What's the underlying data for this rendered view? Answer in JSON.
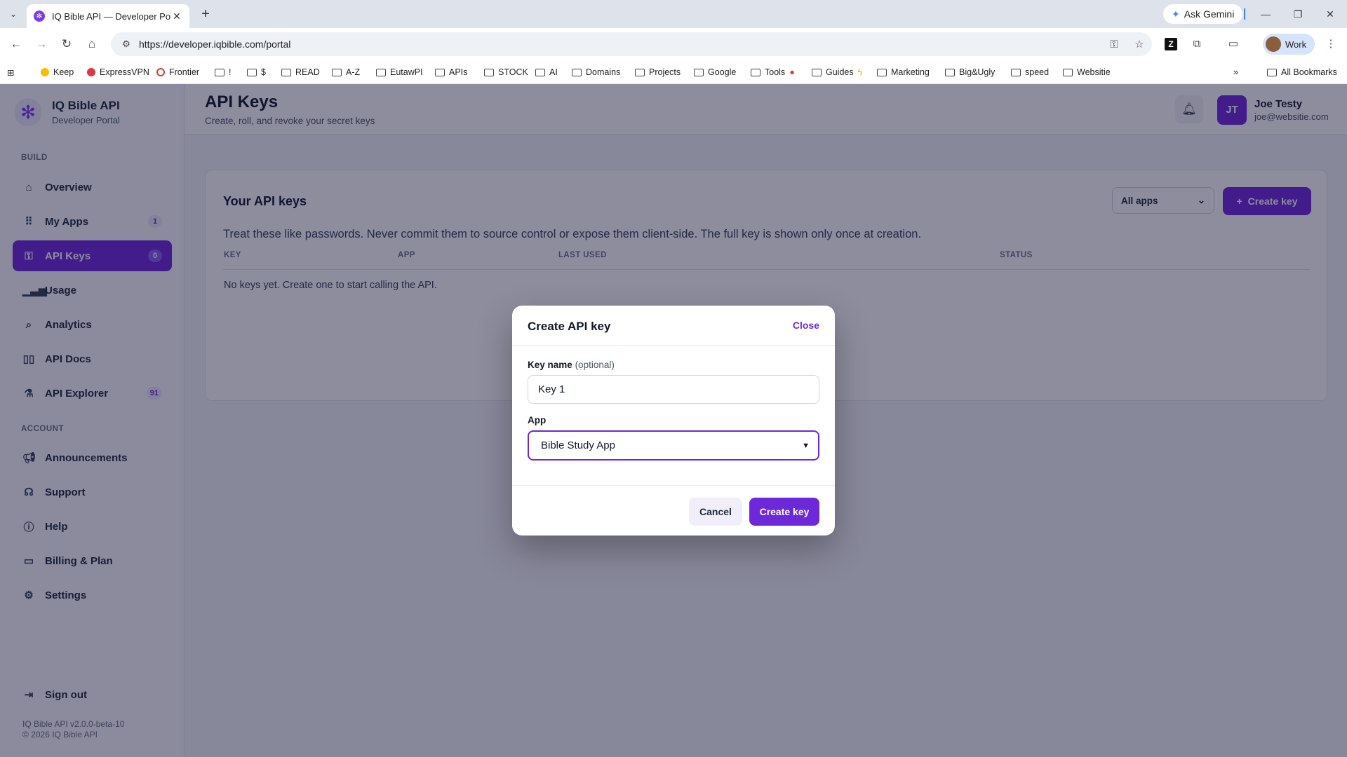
{
  "browser": {
    "tab_title": "IQ Bible API — Developer Portal",
    "url": "https://developer.iqbible.com/portal",
    "ask_gemini": "Ask Gemini",
    "profile_name": "Work",
    "bookmarks": [
      "Keep",
      "ExpressVPN",
      "Frontier",
      "!",
      "$",
      "READ",
      "A-Z",
      "EutawPI",
      "APIs",
      "STOCK",
      "AI",
      "Domains",
      "Projects",
      "Google",
      "Tools",
      "Guides",
      "Marketing",
      "Big&Ugly",
      "speed",
      "Websitie"
    ],
    "all_bookmarks": "All Bookmarks"
  },
  "brand": {
    "name": "IQ Bible API",
    "subtitle": "Developer Portal"
  },
  "sidebar": {
    "build_label": "BUILD",
    "account_label": "ACCOUNT",
    "build_items": [
      {
        "label": "Overview",
        "icon": "home-icon"
      },
      {
        "label": "My Apps",
        "icon": "grid-icon",
        "badge": "1"
      },
      {
        "label": "API Keys",
        "icon": "key-icon",
        "badge": "0",
        "active": true
      },
      {
        "label": "Usage",
        "icon": "bar-chart-icon"
      },
      {
        "label": "Analytics",
        "icon": "analytics-icon"
      },
      {
        "label": "API Docs",
        "icon": "book-icon"
      },
      {
        "label": "API Explorer",
        "icon": "flask-icon",
        "badge": "91"
      }
    ],
    "account_items": [
      {
        "label": "Announcements",
        "icon": "megaphone-icon"
      },
      {
        "label": "Support",
        "icon": "headset-icon"
      },
      {
        "label": "Help",
        "icon": "help-icon"
      },
      {
        "label": "Billing & Plan",
        "icon": "card-icon"
      },
      {
        "label": "Settings",
        "icon": "gear-icon"
      }
    ],
    "sign_out": "Sign out",
    "version": "IQ Bible API v2.0.0-beta-10",
    "copyright": "© 2026 IQ Bible API"
  },
  "header": {
    "title": "API Keys",
    "subtitle": "Create, roll, and revoke your secret keys",
    "user_initials": "JT",
    "user_name": "Joe Testy",
    "user_email": "joe@websitie.com"
  },
  "keys_card": {
    "title": "Your API keys",
    "filter_value": "All apps",
    "create_button": "Create key",
    "note": "Treat these like passwords. Never commit them to source control or expose them client-side. The full key is shown only once at creation.",
    "columns": [
      "KEY",
      "APP",
      "LAST USED",
      "STATUS"
    ],
    "empty_text": "No keys yet. Create one to start calling the API."
  },
  "modal": {
    "title": "Create API key",
    "close_label": "Close",
    "key_name_label": "Key name",
    "key_name_optional": "(optional)",
    "key_name_value": "Key 1",
    "app_label": "App",
    "app_selected": "Bible Study App",
    "cancel_label": "Cancel",
    "create_label": "Create key"
  },
  "colors": {
    "accent": "#6d28d9",
    "overlay": "#111134"
  }
}
